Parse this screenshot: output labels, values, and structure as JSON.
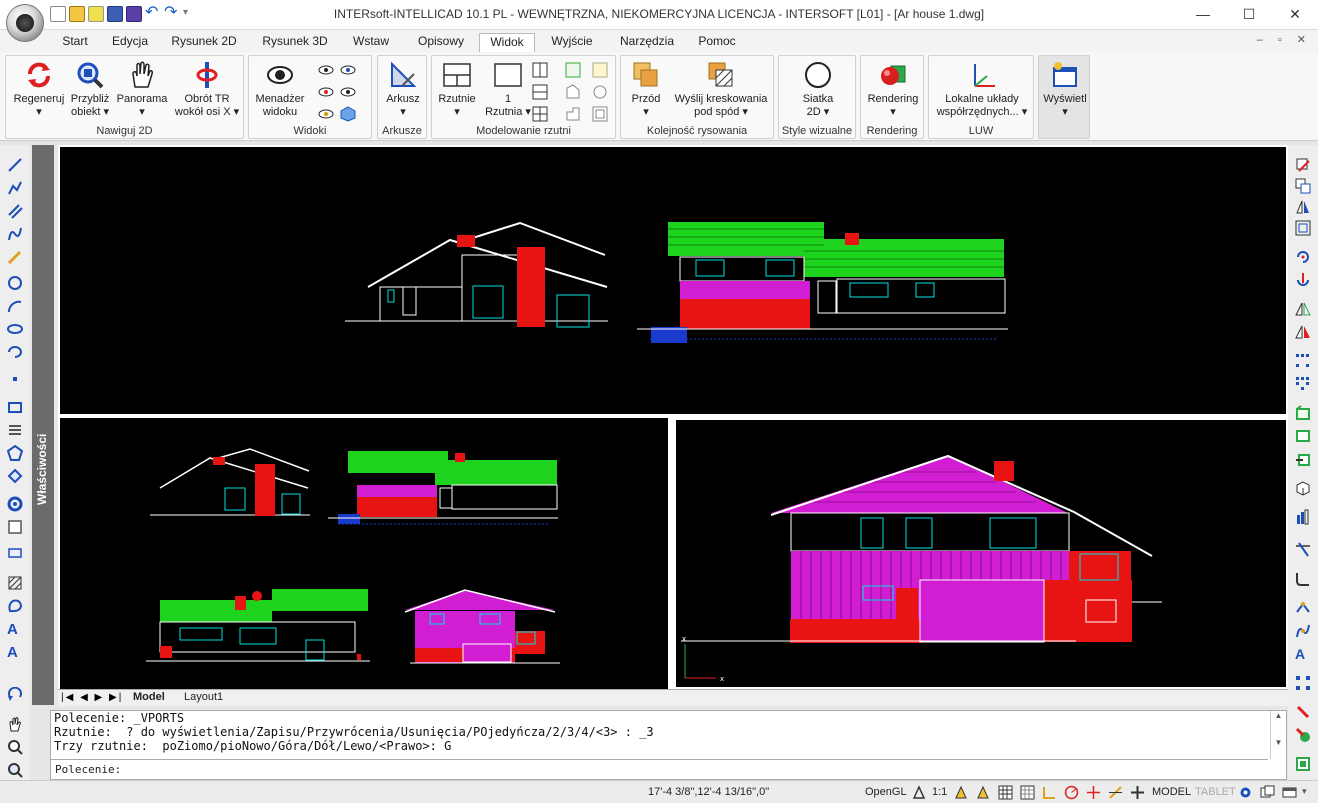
{
  "window": {
    "title": "INTERsoft-INTELLICAD 10.1 PL - WEWNĘTRZNA, NIEKOMERCYJNA LICENCJA - INTERSOFT [L01] - [Ar house 1.dwg]",
    "minimize": "—",
    "maximize": "☐",
    "close": "✕"
  },
  "tabs": [
    "Start",
    "Edycja",
    "Rysunek 2D",
    "Rysunek 3D",
    "Wstaw",
    "Opisowy",
    "Widok",
    "Wyjście",
    "Narzędzia",
    "Pomoc"
  ],
  "active_tab": "Widok",
  "ribbon": {
    "groups": {
      "navigate": "Nawiguj 2D",
      "views": "Widoki",
      "sheet": "Arkusze",
      "modeling": "Modelowanie rzutni",
      "draw_order": "Kolejność rysowania",
      "visual_styles": "Style wizualne",
      "rendering": "Rendering",
      "ucs": "LUW"
    },
    "buttons": {
      "regen_1": "Regeneruj",
      "regen_2": "▾",
      "zoom_1": "Przybliż",
      "zoom_2": "obiekt ▾",
      "pan_1": "Panorama",
      "pan_2": "▾",
      "orbit_1": "Obrót TR",
      "orbit_2": "wokół osi X ▾",
      "view_mgr_1": "Menadżer",
      "view_mgr_2": "widoku",
      "sheet_1": "Arkusz",
      "sheet_2": "▾",
      "viewports_1": "Rzutnie",
      "viewports_2": "▾",
      "one_vp_1": "1",
      "one_vp_2": "Rzutnia ▾",
      "front_1": "Przód",
      "front_2": "▾",
      "hatch_back_1": "Wyślij kreskowania",
      "hatch_back_2": "pod spód ▾",
      "grid_1": "Siatka",
      "grid_2": "2D ▾",
      "render_1": "Rendering",
      "render_2": "▾",
      "ucs_1": "Lokalne układy",
      "ucs_2": "współrzędnych... ▾",
      "display_1": "Wyświetl",
      "display_2": "▾"
    }
  },
  "properties_panel": "Właściwości",
  "layout_tabs": {
    "nav": "|◀ ◀ ▶ ▶|",
    "model": "Model",
    "layout1": "Layout1"
  },
  "command_history": [
    "Polecenie: _VPORTS",
    "Rzutnie:  ? do wyświetlenia/Zapisu/Przywrócenia/Usunięcia/POjedyńcza/2/3/4/<3> : _3",
    "Trzy rzutnie:  poZiomo/pioNowo/Góra/Dół/Lewo/<Prawo>: G"
  ],
  "command_prompt": "Polecenie:",
  "status": {
    "coords": "17'-4 3/8\",12'-4 13/16\",0\"",
    "opengl": "OpenGL",
    "scale": "1:1",
    "model": "MODEL",
    "tablet": "TABLET"
  },
  "colors": {
    "canvas": "#000000",
    "roof_green": "#1ed31e",
    "brick_red": "#e81414",
    "siding_magenta": "#d21ed2",
    "window_cyan": "#00e0e0",
    "line_white": "#ffffff",
    "chimney_red": "#ff1a1a"
  }
}
